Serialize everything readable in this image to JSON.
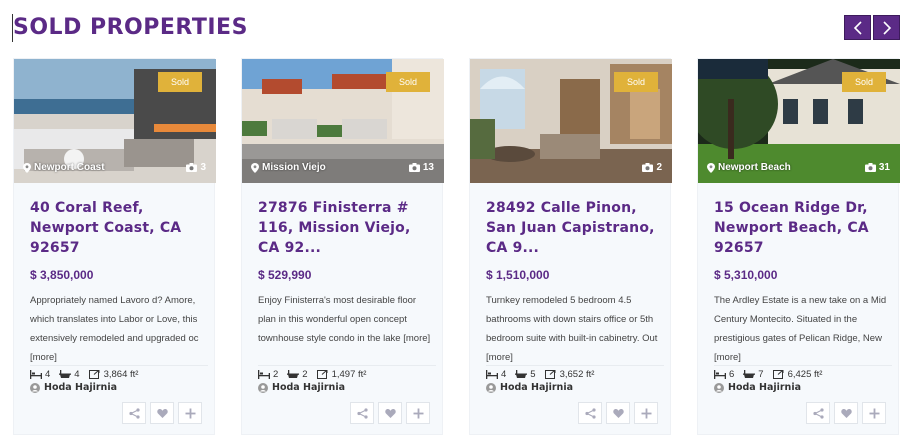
{
  "section": {
    "title": "SOLD PROPERTIES"
  },
  "nav": {
    "prev_icon": "chevron-left-icon",
    "next_icon": "chevron-right-icon"
  },
  "colors": {
    "brand": "#5b2a86",
    "badge": "#e0b23a"
  },
  "cards": [
    {
      "badge": "Sold",
      "location": "Newport Coast",
      "photo_count": "3",
      "address": "40 Coral Reef, Newport Coast, CA 92657",
      "price": "$ 3,850,000",
      "description": "Appropriately named Lavoro d? Amore, which translates into Labor or Love, this extensively remodeled and upgraded oc [more]",
      "beds": "4",
      "baths": "4",
      "area": "3,864 ft²",
      "agent": "Hoda Hajirnia"
    },
    {
      "badge": "Sold",
      "location": "Mission Viejo",
      "photo_count": "13",
      "address": "27876 Finisterra # 116, Mission Viejo, CA 92...",
      "price": "$ 529,990",
      "description": "Enjoy Finisterra's most desirable floor plan in this wonderful open concept townhouse style condo in the lake [more]",
      "beds": "2",
      "baths": "2",
      "area": "1,497 ft²",
      "agent": "Hoda Hajirnia"
    },
    {
      "badge": "Sold",
      "location": "",
      "photo_count": "2",
      "address": "28492 Calle Pinon, San Juan Capistrano, CA 9...",
      "price": "$ 1,510,000",
      "description": "Turnkey remodeled 5 bedroom 4.5 bathrooms with down stairs office or 5th bedroom suite with built-in cabinetry. Out [more]",
      "beds": "4",
      "baths": "5",
      "area": "3,652 ft²",
      "agent": "Hoda Hajirnia"
    },
    {
      "badge": "Sold",
      "location": "Newport Beach",
      "photo_count": "31",
      "address": "15 Ocean Ridge Dr, Newport Beach, CA 92657",
      "price": "$ 5,310,000",
      "description": "The Ardley Estate is a new take on a Mid Century Montecito. Situated in the prestigious gates of Pelican Ridge, New [more]",
      "beds": "6",
      "baths": "7",
      "area": "6,425 ft²",
      "agent": "Hoda Hajirnia"
    }
  ]
}
